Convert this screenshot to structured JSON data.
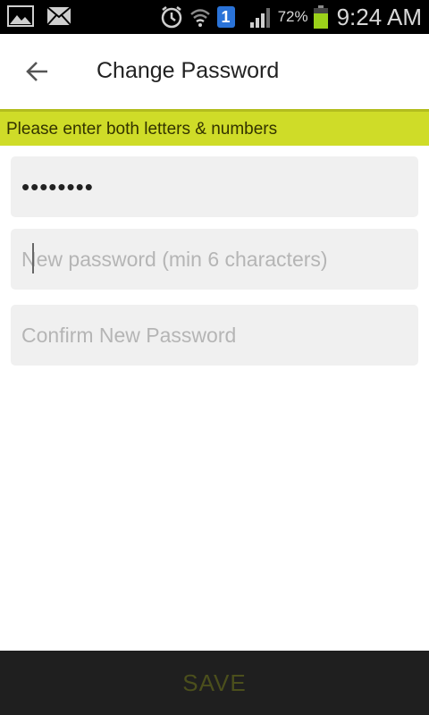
{
  "status_bar": {
    "battery_percent": "72%",
    "time": "9:24 AM",
    "notification_badge": "1",
    "icons": [
      "gallery-icon",
      "mail-icon",
      "alarm-icon",
      "wifi-icon",
      "badge-icon",
      "signal-icon",
      "battery-icon"
    ],
    "battery_level": 0.72,
    "battery_color": "#9bd11a"
  },
  "app_bar": {
    "title": "Change Password",
    "back_icon": "arrow-left-icon"
  },
  "hint": {
    "text": "Please enter both letters & numbers",
    "color": "#cfdc28"
  },
  "form": {
    "current_password": {
      "value": "••••••••",
      "placeholder": ""
    },
    "new_password": {
      "value": "",
      "placeholder": "New password (min 6 characters)"
    },
    "confirm_password": {
      "value": "",
      "placeholder": "Confirm New Password"
    }
  },
  "footer": {
    "save_label": "SAVE",
    "save_color": "#4b4f1c"
  }
}
